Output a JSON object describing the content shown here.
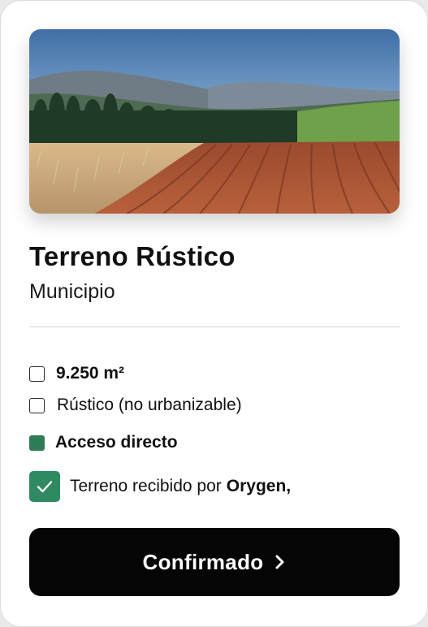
{
  "property": {
    "title": "Terreno Rústico",
    "subtitle": "Municipio",
    "image_subject": "landscape-farmland-image"
  },
  "features": {
    "area": "9.250 m²",
    "classification": "Rústico (no urbanizable)",
    "access": "Acceso directo"
  },
  "receipt": {
    "text": "Terreno recibido por",
    "company": "Orygen,"
  },
  "actions": {
    "confirm_label": "Confirmado"
  },
  "colors": {
    "accent_green": "#2f8a5f",
    "button_bg": "#050505"
  }
}
